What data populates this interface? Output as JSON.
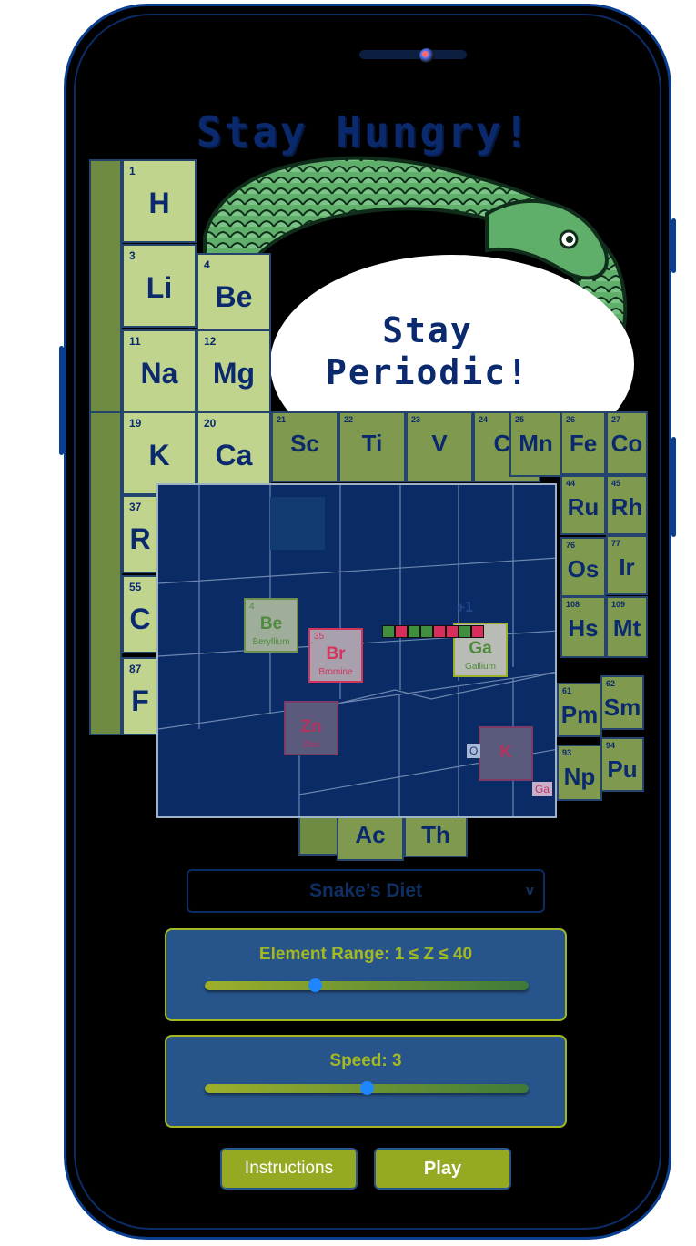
{
  "title": "Stay Hungry!",
  "speech": {
    "line1": "Stay",
    "line2": "Periodic!"
  },
  "periodic_cells": [
    {
      "n": "1",
      "s": "H"
    },
    {
      "n": "3",
      "s": "Li"
    },
    {
      "n": "4",
      "s": "Be"
    },
    {
      "n": "11",
      "s": "Na"
    },
    {
      "n": "12",
      "s": "Mg"
    },
    {
      "n": "19",
      "s": "K"
    },
    {
      "n": "20",
      "s": "Ca"
    },
    {
      "n": "21",
      "s": "Sc"
    },
    {
      "n": "22",
      "s": "Ti"
    },
    {
      "n": "23",
      "s": "V"
    },
    {
      "n": "24",
      "s": "Cr"
    },
    {
      "n": "25",
      "s": "Mn"
    },
    {
      "n": "26",
      "s": "Fe"
    },
    {
      "n": "27",
      "s": "Co"
    },
    {
      "n": "37",
      "s": "R"
    },
    {
      "n": "44",
      "s": "Ru"
    },
    {
      "n": "45",
      "s": "Rh"
    },
    {
      "n": "55",
      "s": "C"
    },
    {
      "n": "76",
      "s": "Os"
    },
    {
      "n": "77",
      "s": "Ir"
    },
    {
      "n": "87",
      "s": "F"
    },
    {
      "n": "108",
      "s": "Hs"
    },
    {
      "n": "109",
      "s": "Mt"
    },
    {
      "n": "61",
      "s": "Pm"
    },
    {
      "n": "62",
      "s": "Sm"
    },
    {
      "n": "93",
      "s": "Np"
    },
    {
      "n": "94",
      "s": "Pu"
    },
    {
      "n": "",
      "s": "Ac"
    },
    {
      "n": "",
      "s": "Th"
    }
  ],
  "board": {
    "tiles": [
      {
        "num": "4",
        "sym": "Be",
        "name": "Beryllium"
      },
      {
        "num": "35",
        "sym": "Br",
        "name": "Bromine"
      },
      {
        "num": "",
        "sym": "Ga",
        "name": "Gallium"
      },
      {
        "num": "",
        "sym": "Zn",
        "name": "Zinc"
      },
      {
        "num": "",
        "sym": "K",
        "name": ""
      }
    ],
    "score_popup": "+1",
    "labels": {
      "o": "O",
      "ga": "Ga"
    },
    "snake_segments": [
      "g",
      "r",
      "g",
      "g",
      "r",
      "r",
      "g",
      "r"
    ]
  },
  "mode_select": {
    "value": "Snake’s Diet",
    "chevron": "v"
  },
  "range_slider": {
    "label": "Element Range: 1 ≤ Z ≤ 40",
    "level": 0.34
  },
  "speed_slider": {
    "label": "Speed: 3",
    "level": 0.5
  },
  "buttons": {
    "instructions": "Instructions",
    "play": "Play"
  }
}
